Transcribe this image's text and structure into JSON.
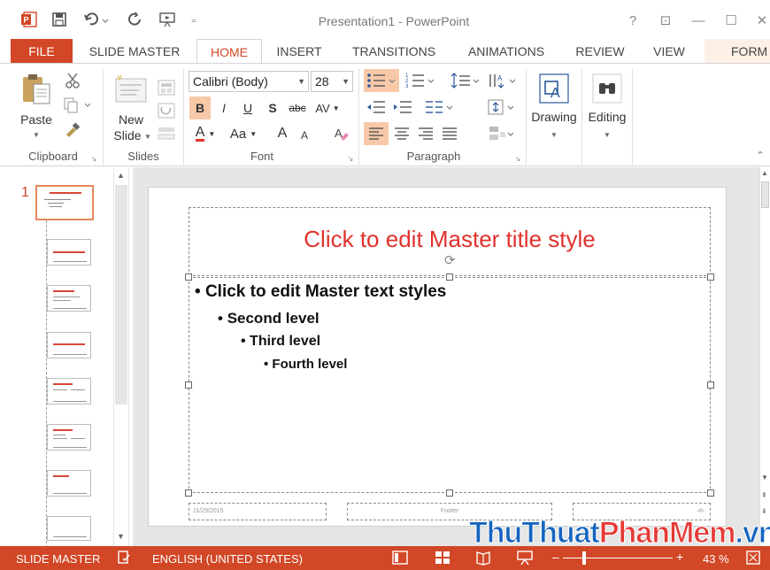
{
  "title_bar": {
    "window_title": "Presentation1 - PowerPoint",
    "help": "?",
    "ribbon_display": "⊡",
    "minimize": "—",
    "maximize": "☐",
    "close": "✕"
  },
  "tabs": [
    "FILE",
    "SLIDE MASTER",
    "HOME",
    "INSERT",
    "TRANSITIONS",
    "ANIMATIONS",
    "REVIEW",
    "VIEW",
    "FORM"
  ],
  "active_tab": "HOME",
  "ribbon": {
    "clipboard": {
      "label": "Clipboard",
      "paste": "Paste"
    },
    "slides": {
      "label": "Slides",
      "new_slide_line1": "New",
      "new_slide_line2": "Slide"
    },
    "font": {
      "label": "Font",
      "family": "Calibri (Body)",
      "size": "28",
      "bold": "B",
      "italic": "I",
      "underline": "U",
      "shadow": "S",
      "strike": "abc",
      "spacing": "AV",
      "font_color": "A",
      "change_case": "Aa",
      "grow": "A",
      "shrink": "A"
    },
    "paragraph": {
      "label": "Paragraph"
    },
    "drawing": {
      "label": "Drawing"
    },
    "editing": {
      "label": "Editing"
    }
  },
  "thumbnails": {
    "first_number": "1",
    "count": 8
  },
  "slide": {
    "title": "Click to edit Master title style",
    "level1": "Click to edit Master text styles",
    "level2": "Second level",
    "level3": "Third level",
    "level4": "Fourth level",
    "footer_date": "11/29/2015",
    "footer_text": "Footer",
    "footer_num": "‹#›"
  },
  "status_bar": {
    "mode": "SLIDE MASTER",
    "language": "ENGLISH (UNITED STATES)",
    "zoom": "43 %",
    "zoom_fraction": 0.43
  },
  "watermark": {
    "part1": "ThuThuat",
    "part2": "PhanMem",
    "part3": ".vn"
  },
  "colors": {
    "accent": "#d24726",
    "title_red": "#e0322b",
    "highlight": "#f8c9a8"
  }
}
